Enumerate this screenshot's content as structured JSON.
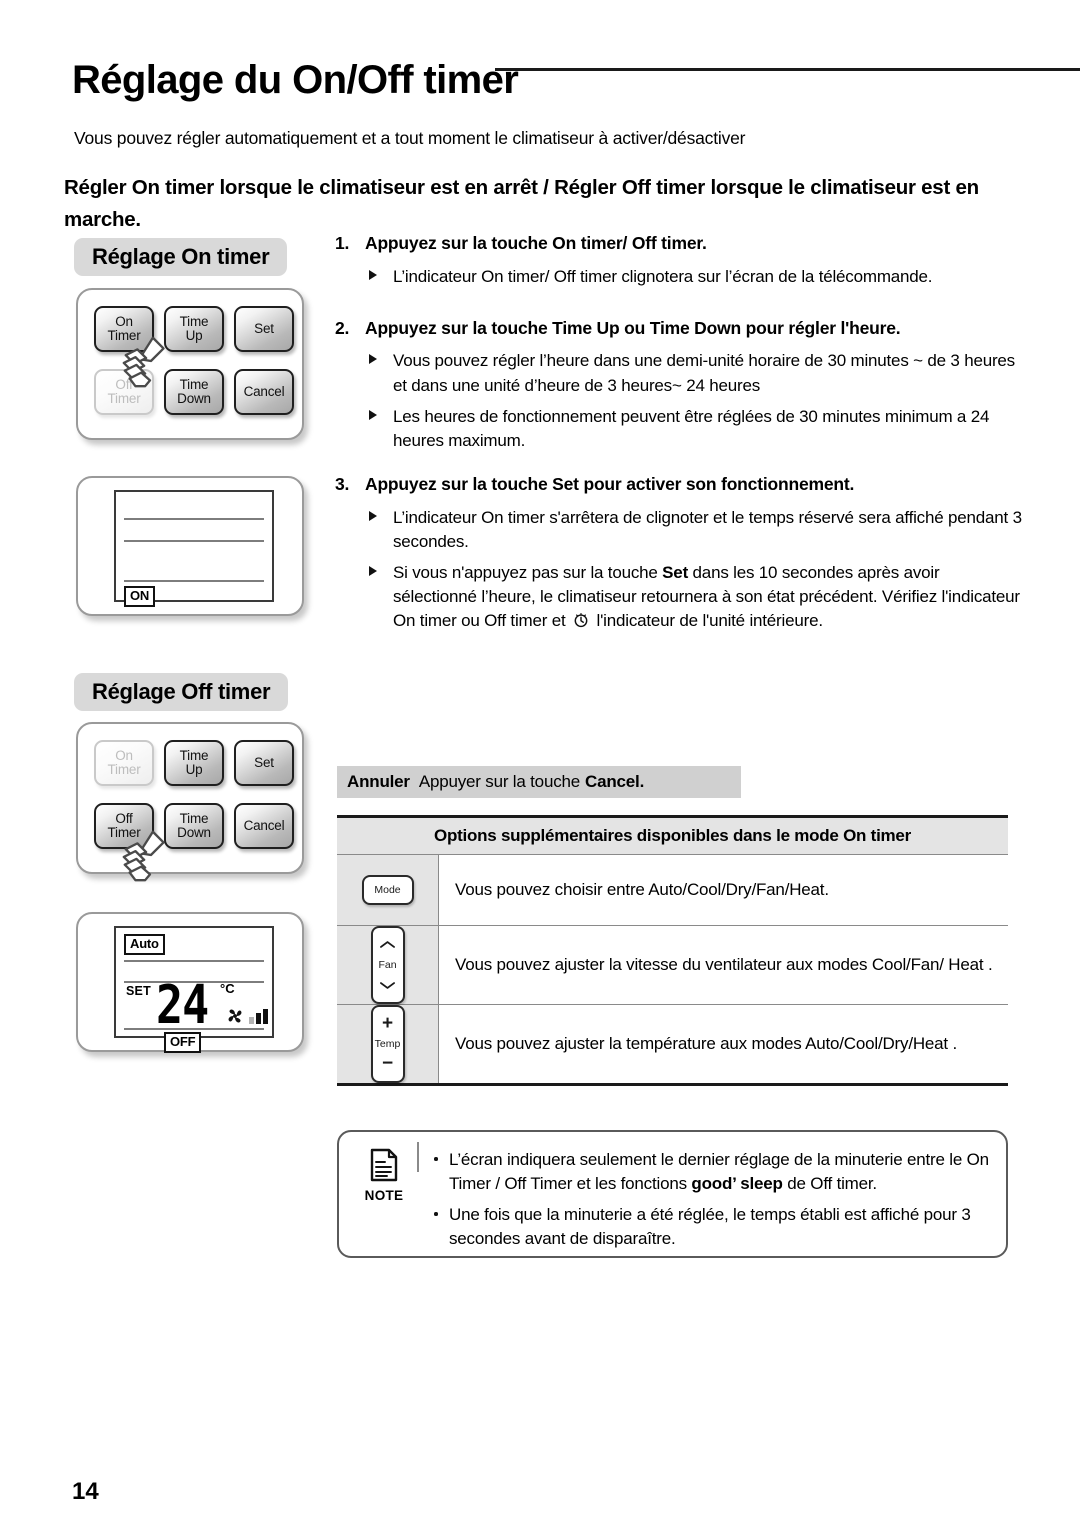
{
  "page": {
    "title": "Réglage du On/Off timer",
    "intro": "Vous pouvez régler automatiquement et a tout moment le climatiseur à activer/désactiver",
    "section_lead": "Régler On timer  lorsque le climatiseur est en arrêt / Régler Off timer lorsque le climatiseur est en marche.",
    "number": "14"
  },
  "on_timer_section": {
    "badge": "Réglage On timer",
    "remote": {
      "buttons": [
        {
          "line1": "On",
          "line2": "Timer",
          "state": "active"
        },
        {
          "line1": "Time",
          "line2": "Up",
          "state": "active"
        },
        {
          "line1": "Set",
          "line2": "",
          "state": "active"
        },
        {
          "line1": "Off",
          "line2": "Timer",
          "state": "dim"
        },
        {
          "line1": "Time",
          "line2": "Down",
          "state": "active"
        },
        {
          "line1": "Cancel",
          "line2": "",
          "state": "active"
        }
      ],
      "pointed_button": "On Timer"
    },
    "lcd": {
      "indicator": "ON"
    }
  },
  "off_timer_section": {
    "badge": "Réglage Off timer",
    "remote": {
      "buttons": [
        {
          "line1": "On",
          "line2": "Timer",
          "state": "dim"
        },
        {
          "line1": "Time",
          "line2": "Up",
          "state": "active"
        },
        {
          "line1": "Set",
          "line2": "",
          "state": "active"
        },
        {
          "line1": "Off",
          "line2": "Timer",
          "state": "active"
        },
        {
          "line1": "Time",
          "line2": "Down",
          "state": "active"
        },
        {
          "line1": "Cancel",
          "line2": "",
          "state": "active"
        }
      ],
      "pointed_button": "Off Timer"
    },
    "lcd": {
      "mode": "Auto",
      "set_label": "SET",
      "temperature": "24",
      "unit": "°C",
      "indicator": "OFF"
    }
  },
  "steps": [
    {
      "num": "1.",
      "title": "Appuyez sur la touche On timer/ Off timer.",
      "bullets": [
        "L’indicateur On timer/ Off timer clignotera sur l’écran de la télécommande."
      ]
    },
    {
      "num": "2.",
      "title": "Appuyez sur la touche Time Up ou Time Down pour régler l'heure.",
      "bullets": [
        "Vous pouvez régler l’heure dans une demi-unité horaire de 30 minutes ~ de 3 heures et dans une unité d’heure de 3 heures~ 24 heures",
        "Les heures de fonctionnement peuvent être réglées de 30 minutes minimum a 24 heures maximum."
      ]
    },
    {
      "num": "3.",
      "title": "Appuyez sur la touche Set pour activer son fonctionnement.",
      "bullets": [
        "L’indicateur On timer s'arrêtera de clignoter et le temps réservé sera affiché pendant 3 secondes."
      ]
    }
  ],
  "step3_last_bullet": {
    "part1": "Si vous n'appuyez pas sur la touche ",
    "bold": "Set",
    "part2": " dans les 10 secondes après avoir sélectionné l’heure, le climatiseur retournera à son état précédent. Vérifiez l'indicateur On timer ou Off timer et ",
    "part3": " l'indicateur de l'unité intérieure."
  },
  "annuler": {
    "label": "Annuler",
    "text": "Appuyer sur la touche ",
    "bold": "Cancel."
  },
  "options_table": {
    "header": "Options supplémentaires disponibles dans le mode On timer",
    "rows": [
      {
        "icon": "mode-button-icon",
        "icon_label": "Mode",
        "text": "Vous pouvez choisir entre Auto/Cool/Dry/Fan/Heat."
      },
      {
        "icon": "fan-button-icon",
        "icon_label": "Fan",
        "text": "Vous pouvez ajuster la vitesse du ventilateur aux modes Cool/Fan/ Heat ."
      },
      {
        "icon": "temp-button-icon",
        "icon_label": "Temp",
        "text": "Vous pouvez ajuster la température aux modes Auto/Cool/Dry/Heat ."
      }
    ]
  },
  "note": {
    "label": "NOTE",
    "items": [
      {
        "part1": "L’écran indiquera seulement le dernier réglage de la minuterie entre le On Timer / Off Timer et les fonctions ",
        "bold": "good’ sleep",
        "part2": " de Off timer."
      },
      {
        "part1": "Une fois que la minuterie a été réglée, le temps établi est affiché pour 3 secondes avant de disparaître.",
        "bold": "",
        "part2": ""
      }
    ]
  }
}
